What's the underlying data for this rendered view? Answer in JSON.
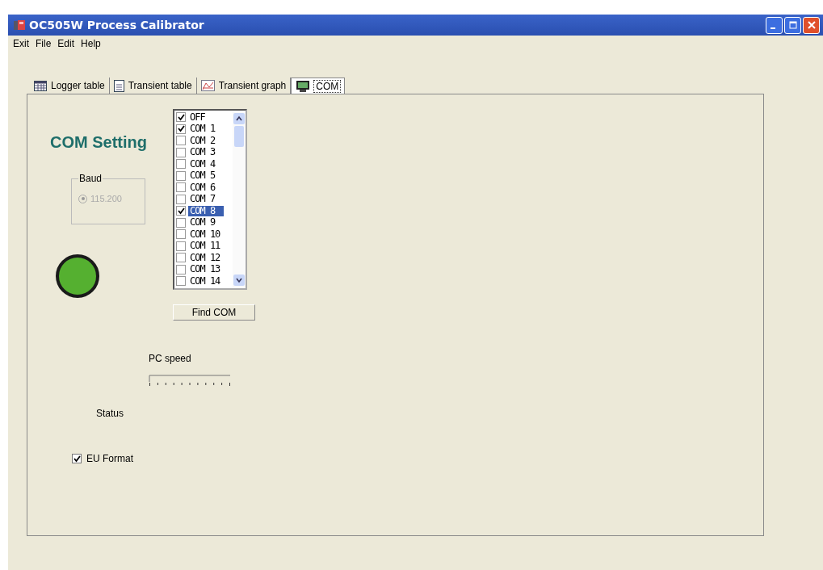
{
  "window": {
    "title": "OC505W Process Calibrator"
  },
  "menu": [
    "Exit",
    "File",
    "Edit",
    "Help"
  ],
  "tabs": [
    {
      "label": "Logger table",
      "kind": "grid",
      "selected": false
    },
    {
      "label": "Transient table",
      "kind": "doc",
      "selected": false
    },
    {
      "label": "Transient graph",
      "kind": "graph",
      "selected": false
    },
    {
      "label": "COM",
      "kind": "monitor",
      "selected": true
    }
  ],
  "heading": "COM Setting",
  "baud": {
    "label": "Baud",
    "option": "115.200",
    "selected": true,
    "disabled": true
  },
  "ports": [
    {
      "label": "OFF",
      "checked": true,
      "selected": false
    },
    {
      "label": "COM 1",
      "checked": true,
      "selected": false
    },
    {
      "label": "COM 2",
      "checked": false,
      "selected": false
    },
    {
      "label": "COM 3",
      "checked": false,
      "selected": false
    },
    {
      "label": "COM 4",
      "checked": false,
      "selected": false
    },
    {
      "label": "COM 5",
      "checked": false,
      "selected": false
    },
    {
      "label": "COM 6",
      "checked": false,
      "selected": false
    },
    {
      "label": "COM 7",
      "checked": false,
      "selected": false
    },
    {
      "label": "COM 8",
      "checked": true,
      "selected": true
    },
    {
      "label": "COM 9",
      "checked": false,
      "selected": false
    },
    {
      "label": "COM 10",
      "checked": false,
      "selected": false
    },
    {
      "label": "COM 11",
      "checked": false,
      "selected": false
    },
    {
      "label": "COM 12",
      "checked": false,
      "selected": false
    },
    {
      "label": "COM 13",
      "checked": false,
      "selected": false
    },
    {
      "label": "COM 14",
      "checked": false,
      "selected": false
    }
  ],
  "find_button": "Find COM",
  "pc_speed": {
    "label": "PC speed"
  },
  "status_label": "Status",
  "eu_format": {
    "label": "EU Format",
    "checked": true
  }
}
